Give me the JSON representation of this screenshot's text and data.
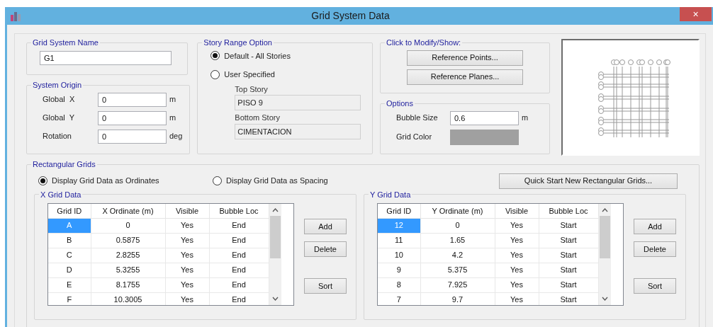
{
  "window": {
    "title": "Grid System Data",
    "close": "×"
  },
  "grid_system_name": {
    "title": "Grid System Name",
    "value": "G1"
  },
  "system_origin": {
    "title": "System Origin",
    "fields": [
      {
        "label": "Global  X",
        "value": "0",
        "unit": "m"
      },
      {
        "label": "Global  Y",
        "value": "0",
        "unit": "m"
      },
      {
        "label": "Rotation",
        "value": "0",
        "unit": "deg"
      }
    ]
  },
  "story_range": {
    "title": "Story Range Option",
    "options": [
      {
        "label": "Default - All Stories",
        "selected": true
      },
      {
        "label": "User Specified",
        "selected": false
      }
    ],
    "fields": [
      {
        "label": "Top Story",
        "value": "PISO 9",
        "disabled": true
      },
      {
        "label": "Bottom Story",
        "value": "CIMENTACION",
        "disabled": true
      }
    ]
  },
  "modify": {
    "title": "Click to Modify/Show:",
    "buttons": [
      "Reference Points...",
      "Reference Planes..."
    ]
  },
  "options": {
    "title": "Options",
    "bubble_size": {
      "label": "Bubble Size",
      "value": "0.6",
      "unit": "m"
    },
    "grid_color": {
      "label": "Grid Color",
      "color": "#a0a0a0"
    }
  },
  "rectangular_grids": {
    "title": "Rectangular Grids",
    "display_options": [
      {
        "label": "Display Grid Data as Ordinates",
        "selected": true
      },
      {
        "label": "Display Grid Data as Spacing",
        "selected": false
      }
    ],
    "quick_start": "Quick Start New Rectangular Grids...",
    "tables": [
      {
        "title": "X Grid Data",
        "columns": [
          "Grid ID",
          "X Ordinate (m)",
          "Visible",
          "Bubble Loc"
        ],
        "rows": [
          {
            "cells": [
              "A",
              "0",
              "Yes",
              "End"
            ],
            "selected": true
          },
          {
            "cells": [
              "B",
              "0.5875",
              "Yes",
              "End"
            ],
            "selected": false
          },
          {
            "cells": [
              "C",
              "2.8255",
              "Yes",
              "End"
            ],
            "selected": false
          },
          {
            "cells": [
              "D",
              "5.3255",
              "Yes",
              "End"
            ],
            "selected": false
          },
          {
            "cells": [
              "E",
              "8.1755",
              "Yes",
              "End"
            ],
            "selected": false
          },
          {
            "cells": [
              "F",
              "10.3005",
              "Yes",
              "End"
            ],
            "selected": false
          }
        ],
        "buttons": [
          "Add",
          "Delete",
          "Sort"
        ]
      },
      {
        "title": "Y Grid Data",
        "columns": [
          "Grid ID",
          "Y Ordinate (m)",
          "Visible",
          "Bubble Loc"
        ],
        "rows": [
          {
            "cells": [
              "12",
              "0",
              "Yes",
              "Start"
            ],
            "selected": true
          },
          {
            "cells": [
              "11",
              "1.65",
              "Yes",
              "Start"
            ],
            "selected": false
          },
          {
            "cells": [
              "10",
              "4.2",
              "Yes",
              "Start"
            ],
            "selected": false
          },
          {
            "cells": [
              "9",
              "5.375",
              "Yes",
              "Start"
            ],
            "selected": false
          },
          {
            "cells": [
              "8",
              "7.925",
              "Yes",
              "Start"
            ],
            "selected": false
          },
          {
            "cells": [
              "7",
              "9.7",
              "Yes",
              "Start"
            ],
            "selected": false
          }
        ],
        "buttons": [
          "Add",
          "Delete",
          "Sort"
        ]
      }
    ]
  }
}
